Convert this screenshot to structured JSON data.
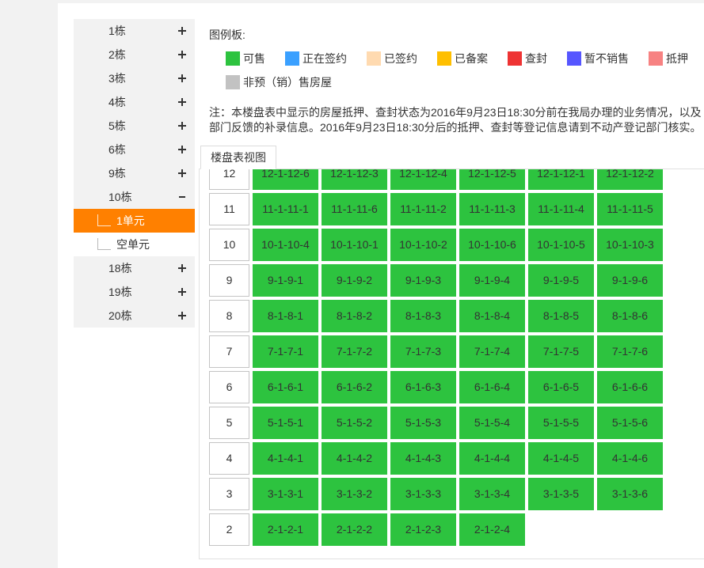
{
  "colors": {
    "accent": "#ff8000",
    "sidebar_bg": "#f2f2f2"
  },
  "sidebar": {
    "items": [
      {
        "label": "1栋",
        "icon": "plus-icon"
      },
      {
        "label": "2栋",
        "icon": "plus-icon"
      },
      {
        "label": "3栋",
        "icon": "plus-icon"
      },
      {
        "label": "4栋",
        "icon": "plus-icon"
      },
      {
        "label": "5栋",
        "icon": "plus-icon"
      },
      {
        "label": "6栋",
        "icon": "plus-icon"
      },
      {
        "label": "9栋",
        "icon": "plus-icon"
      },
      {
        "label": "10栋",
        "icon": "minus-icon",
        "expanded": true
      },
      {
        "label": "1单元",
        "icon": "tree-connector-icon",
        "selected": true
      },
      {
        "label": "空单元",
        "icon": "tree-connector-icon"
      },
      {
        "label": "18栋",
        "icon": "plus-icon"
      },
      {
        "label": "19栋",
        "icon": "plus-icon"
      },
      {
        "label": "20栋",
        "icon": "plus-icon"
      }
    ]
  },
  "legend": {
    "title": "图例板:",
    "items": [
      {
        "label": "可售",
        "color": "#2dc33f"
      },
      {
        "label": "正在签约",
        "color": "#3aa0ff"
      },
      {
        "label": "已签约",
        "color": "#ffdab0"
      },
      {
        "label": "已备案",
        "color": "#ffbf00"
      },
      {
        "label": "查封",
        "color": "#ee3333"
      },
      {
        "label": "暂不销售",
        "color": "#5656ff"
      },
      {
        "label": "抵押",
        "color": "#f78282"
      },
      {
        "label": "非预（销）售房屋",
        "color": "#c2c2c2"
      }
    ]
  },
  "note": {
    "lines": [
      "注：本楼盘表中显示的房屋抵押、查封状态为2016年9月23日18:30分前在我局办理的业务情况，以及",
      "部门反馈的补录信息。2016年9月23日18:30分后的抵押、查封等登记信息请到不动产登记部门核实。"
    ]
  },
  "tabs": [
    {
      "label": "楼盘表视图",
      "active": true
    }
  ],
  "building_table": {
    "unit_color": "#2dc33f",
    "rows": [
      {
        "floor": "12",
        "units": [
          "12-1-12-6",
          "12-1-12-3",
          "12-1-12-4",
          "12-1-12-5",
          "12-1-12-1",
          "12-1-12-2"
        ]
      },
      {
        "floor": "11",
        "units": [
          "11-1-11-1",
          "11-1-11-6",
          "11-1-11-2",
          "11-1-11-3",
          "11-1-11-4",
          "11-1-11-5"
        ]
      },
      {
        "floor": "10",
        "units": [
          "10-1-10-4",
          "10-1-10-1",
          "10-1-10-2",
          "10-1-10-6",
          "10-1-10-5",
          "10-1-10-3"
        ]
      },
      {
        "floor": "9",
        "units": [
          "9-1-9-1",
          "9-1-9-2",
          "9-1-9-3",
          "9-1-9-4",
          "9-1-9-5",
          "9-1-9-6"
        ]
      },
      {
        "floor": "8",
        "units": [
          "8-1-8-1",
          "8-1-8-2",
          "8-1-8-3",
          "8-1-8-4",
          "8-1-8-5",
          "8-1-8-6"
        ]
      },
      {
        "floor": "7",
        "units": [
          "7-1-7-1",
          "7-1-7-2",
          "7-1-7-3",
          "7-1-7-4",
          "7-1-7-5",
          "7-1-7-6"
        ]
      },
      {
        "floor": "6",
        "units": [
          "6-1-6-1",
          "6-1-6-2",
          "6-1-6-3",
          "6-1-6-4",
          "6-1-6-5",
          "6-1-6-6"
        ]
      },
      {
        "floor": "5",
        "units": [
          "5-1-5-1",
          "5-1-5-2",
          "5-1-5-3",
          "5-1-5-4",
          "5-1-5-5",
          "5-1-5-6"
        ]
      },
      {
        "floor": "4",
        "units": [
          "4-1-4-1",
          "4-1-4-2",
          "4-1-4-3",
          "4-1-4-4",
          "4-1-4-5",
          "4-1-4-6"
        ]
      },
      {
        "floor": "3",
        "units": [
          "3-1-3-1",
          "3-1-3-2",
          "3-1-3-3",
          "3-1-3-4",
          "3-1-3-5",
          "3-1-3-6"
        ]
      },
      {
        "floor": "2",
        "units": [
          "2-1-2-1",
          "2-1-2-2",
          "2-1-2-3",
          "2-1-2-4"
        ]
      }
    ]
  }
}
